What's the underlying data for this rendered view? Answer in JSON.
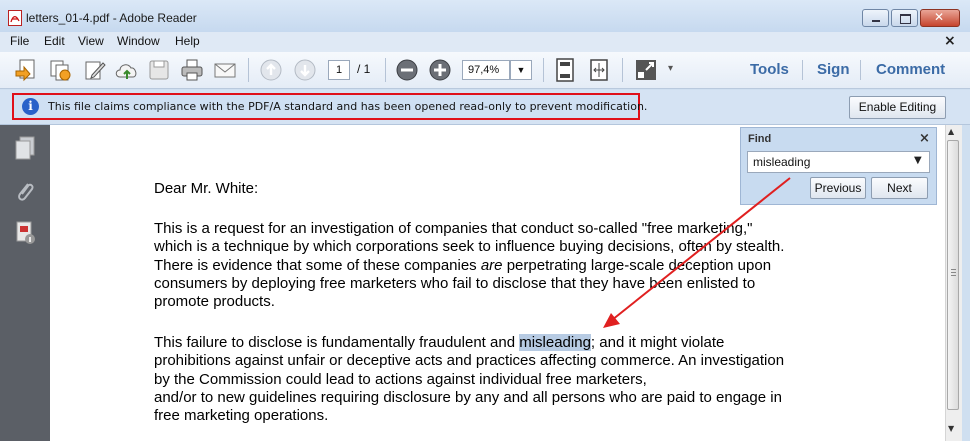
{
  "window": {
    "title": "letters_01-4.pdf - Adobe Reader",
    "close_glyph": "✕",
    "min_glyph": "–",
    "max_glyph": "□"
  },
  "menu": {
    "items": [
      "File",
      "Edit",
      "View",
      "Window",
      "Help"
    ],
    "close_glyph": "×"
  },
  "toolbar": {
    "page_current": "1",
    "page_total": "/ 1",
    "zoom": "97,4%",
    "tools_label": "Tools",
    "sign_label": "Sign",
    "comment_label": "Comment",
    "icons": [
      "create-pdf-icon",
      "combine-icon",
      "edit-icon",
      "upload-cloud-icon",
      "save-icon",
      "print-icon",
      "email-icon",
      "prev-page-icon",
      "next-page-icon",
      "zoom-out-icon",
      "zoom-in-icon",
      "fit-page-icon",
      "fit-width-icon",
      "fullscreen-icon",
      "more-icon"
    ]
  },
  "infobar": {
    "message": "This file claims compliance with the PDF/A standard and has been opened read-only to prevent modification.",
    "enable_editing": "Enable Editing"
  },
  "find": {
    "title": "Find",
    "close": "×",
    "query": "misleading",
    "previous": "Previous",
    "next": "Next"
  },
  "document": {
    "salutation": "Dear Mr. White:",
    "para1": [
      "This is a request for an investigation of companies that conduct so-called \"free marketing,\"",
      "which is a technique by which corporations seek to influence buying decisions, often by stealth.",
      "consumers by deploying free marketers who fail to disclose that they have been enlisted to",
      "promote products."
    ],
    "para1_line3_a": "There is evidence that some of these companies ",
    "para1_line3_em": "are",
    "para1_line3_b": " perpetrating large-scale deception upon",
    "para2_line1_a": "This failure to disclose is fundamentally fraudulent and ",
    "para2_line1_hl": "misleading",
    "para2_line1_b": "; and it might violate",
    "para2": [
      "prohibitions against unfair or deceptive acts and practices affecting commerce. An investigation",
      "by the Commission could lead to actions against individual free marketers,",
      "and/or to new guidelines requiring disclosure by any and all persons who are paid to engage in",
      "free marketing operations."
    ]
  },
  "colors": {
    "highlight_border": "#e0101a",
    "accent_link": "#3b6ba6",
    "annotation_arrow": "#e02020",
    "search_highlight": "#b7cbe3"
  }
}
